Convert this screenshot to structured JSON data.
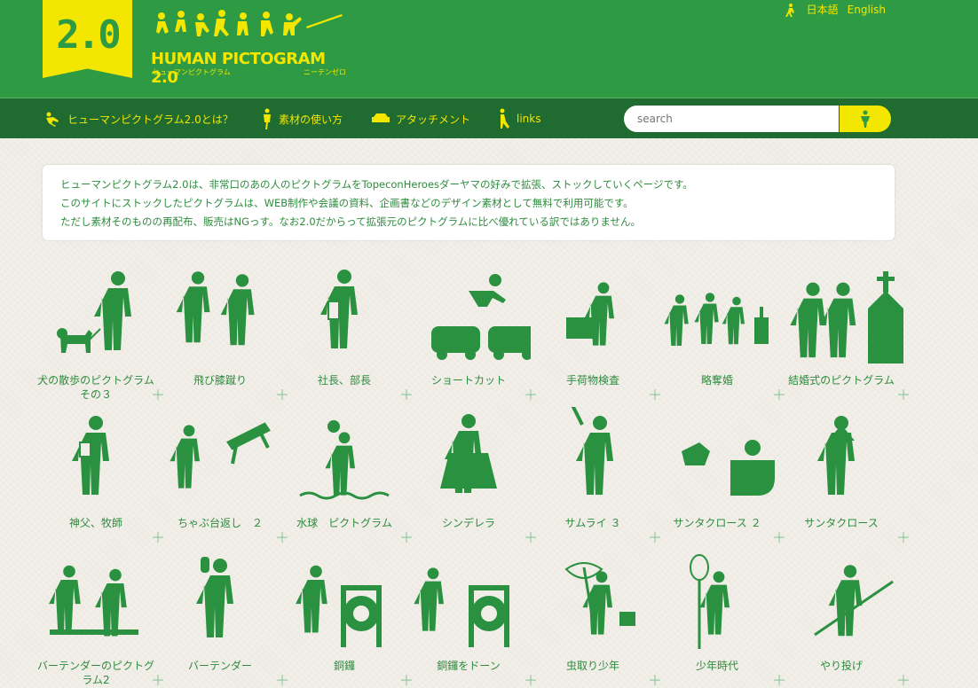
{
  "header": {
    "badge": "2.0",
    "brand_title": "HUMAN PICTOGRAM 2.0",
    "brand_sub_left": "ヒューマンピクトグラム",
    "brand_sub_right": "ニーテンゼロ",
    "lang_ja": "日本語",
    "lang_en": "English"
  },
  "nav": {
    "items": [
      {
        "label": "ヒューマンピクトグラム2.0とは？",
        "icon": "running-figure-icon"
      },
      {
        "label": "素材の使い方",
        "icon": "standing-figure-icon"
      },
      {
        "label": "アタッチメント",
        "icon": "car-icon"
      },
      {
        "label": "links",
        "icon": "leaning-figure-icon"
      }
    ],
    "search_placeholder": "search"
  },
  "intro": {
    "lines": [
      "ヒューマンピクトグラム2.0は、非常口のあの人のピクトグラムをTopeconHeroesダーヤマの好みで拡張、ストックしていくページです。",
      "このサイトにストックしたピクトグラムは、WEB制作や会議の資料、企画書などのデザイン素材として無料で利用可能です。",
      "ただし素材そのものの再配布、販売はNGっす。なお2.0だからって拡張元のピクトグラムに比べ優れている訳ではありません。"
    ]
  },
  "pictograms": [
    {
      "label": "犬の散歩のピクトグラム その３",
      "icon": "dog-walk-icon"
    },
    {
      "label": "飛び膝蹴り",
      "icon": "flying-knee-icon"
    },
    {
      "label": "社長、部長",
      "icon": "boss-icon"
    },
    {
      "label": "ショートカット",
      "icon": "shortcut-icon"
    },
    {
      "label": "手荷物検査",
      "icon": "baggage-check-icon"
    },
    {
      "label": "略奪婚",
      "icon": "bride-steal-icon"
    },
    {
      "label": "結婚式のピクトグラム",
      "icon": "wedding-icon"
    },
    {
      "label": "神父、牧師",
      "icon": "priest-icon"
    },
    {
      "label": "ちゃぶ台返し　２",
      "icon": "table-flip-icon"
    },
    {
      "label": "水球　ピクトグラム",
      "icon": "water-polo-icon"
    },
    {
      "label": "シンデレラ",
      "icon": "cinderella-icon"
    },
    {
      "label": "サムライ ３",
      "icon": "samurai-icon"
    },
    {
      "label": "サンタクロース ２",
      "icon": "santa-sleigh-icon"
    },
    {
      "label": "サンタクロース",
      "icon": "santa-icon"
    },
    {
      "label": "バーテンダーのピクトグラム2",
      "icon": "bartender-bar-icon"
    },
    {
      "label": "バーテンダー",
      "icon": "bartender-icon"
    },
    {
      "label": "銅鑼",
      "icon": "gong-icon"
    },
    {
      "label": "銅鑼をドーン",
      "icon": "gong-strike-icon"
    },
    {
      "label": "虫取り少年",
      "icon": "bug-catcher-icon"
    },
    {
      "label": "少年時代",
      "icon": "boyhood-icon"
    },
    {
      "label": "やり投げ",
      "icon": "javelin-icon"
    }
  ],
  "plus_symbol": "＋",
  "colors": {
    "green": "#2e9a44",
    "dark_green": "#1f6b30",
    "yellow": "#f3e600",
    "pict": "#2a9140"
  }
}
